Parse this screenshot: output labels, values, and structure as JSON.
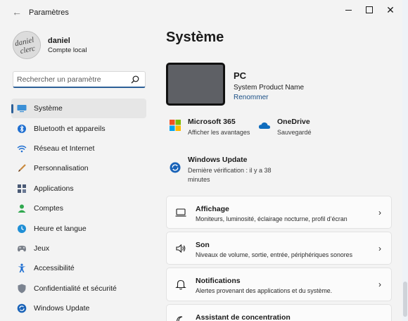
{
  "window": {
    "title": "Paramètres"
  },
  "profile": {
    "name": "daniel",
    "account_type": "Compte local",
    "avatar_text_1": "daniel",
    "avatar_text_2": "clerc"
  },
  "search": {
    "placeholder": "Rechercher un paramètre"
  },
  "nav": [
    {
      "label": "Système",
      "icon": "monitor-icon",
      "active": true
    },
    {
      "label": "Bluetooth et appareils",
      "icon": "bluetooth-icon"
    },
    {
      "label": "Réseau et Internet",
      "icon": "wifi-icon"
    },
    {
      "label": "Personnalisation",
      "icon": "brush-icon"
    },
    {
      "label": "Applications",
      "icon": "apps-icon"
    },
    {
      "label": "Comptes",
      "icon": "account-icon"
    },
    {
      "label": "Heure et langue",
      "icon": "globe-clock-icon"
    },
    {
      "label": "Jeux",
      "icon": "gamepad-icon"
    },
    {
      "label": "Accessibilité",
      "icon": "accessibility-icon"
    },
    {
      "label": "Confidentialité et sécurité",
      "icon": "shield-icon"
    },
    {
      "label": "Windows Update",
      "icon": "update-icon"
    }
  ],
  "main": {
    "title": "Système",
    "device": {
      "name": "PC",
      "model": "System Product Name",
      "rename": "Renommer"
    },
    "m365": {
      "title": "Microsoft 365",
      "subtitle": "Afficher les avantages"
    },
    "onedrive": {
      "title": "OneDrive",
      "subtitle": "Sauvegardé"
    },
    "update": {
      "title": "Windows Update",
      "subtitle_line1": "Dernière vérification : il y a 38",
      "subtitle_line2": "minutes"
    },
    "cards": [
      {
        "title": "Affichage",
        "subtitle": "Moniteurs, luminosité, éclairage nocturne, profil d’écran",
        "icon": "display-icon"
      },
      {
        "title": "Son",
        "subtitle": "Niveaux de volume, sortie, entrée, périphériques sonores",
        "icon": "speaker-icon"
      },
      {
        "title": "Notifications",
        "subtitle": "Alertes provenant des applications et du système.",
        "icon": "bell-icon"
      },
      {
        "title": "Assistant de concentration",
        "subtitle": "",
        "icon": "moon-icon"
      }
    ]
  },
  "colors": {
    "accent": "#2c5f97",
    "link": "#1a4f86",
    "background": "#f3f3f3",
    "card": "#fbfbfb"
  }
}
